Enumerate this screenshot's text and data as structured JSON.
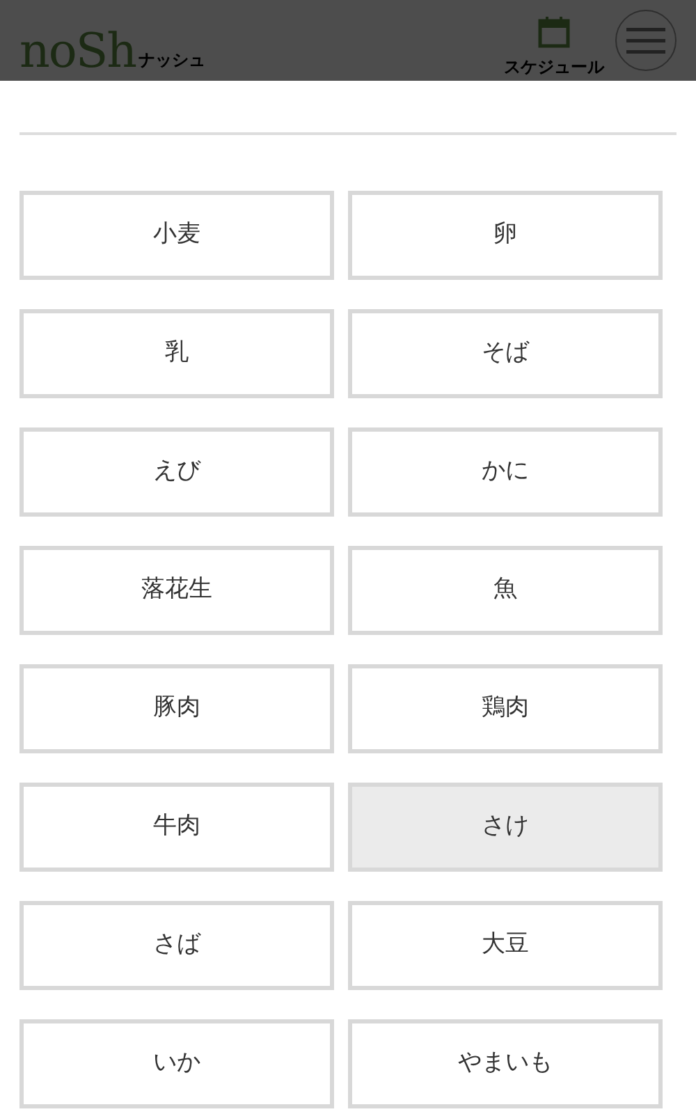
{
  "header": {
    "logo": "noSh",
    "logo_sub": "ナッシュ",
    "schedule_label": "スケジュール"
  },
  "allergens": [
    {
      "label": "小麦",
      "selected": false
    },
    {
      "label": "卵",
      "selected": false
    },
    {
      "label": "乳",
      "selected": false
    },
    {
      "label": "そば",
      "selected": false
    },
    {
      "label": "えび",
      "selected": false
    },
    {
      "label": "かに",
      "selected": false
    },
    {
      "label": "落花生",
      "selected": false
    },
    {
      "label": "魚",
      "selected": false
    },
    {
      "label": "豚肉",
      "selected": false
    },
    {
      "label": "鶏肉",
      "selected": false
    },
    {
      "label": "牛肉",
      "selected": false
    },
    {
      "label": "さけ",
      "selected": true
    },
    {
      "label": "さば",
      "selected": false
    },
    {
      "label": "大豆",
      "selected": false
    },
    {
      "label": "いか",
      "selected": false
    },
    {
      "label": "やまいも",
      "selected": false
    }
  ]
}
